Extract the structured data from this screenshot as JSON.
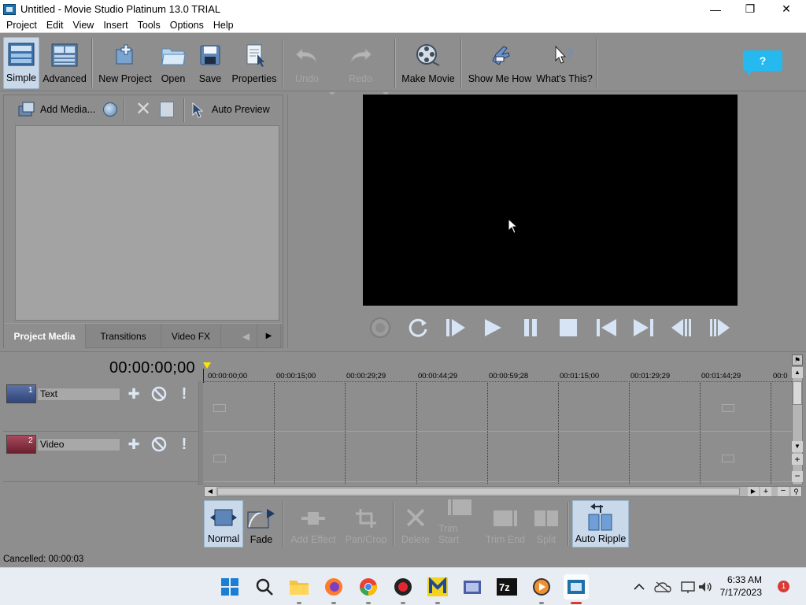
{
  "window": {
    "title": "Untitled - Movie Studio Platinum 13.0 TRIAL"
  },
  "menu": [
    "Project",
    "Edit",
    "View",
    "Insert",
    "Tools",
    "Options",
    "Help"
  ],
  "toolbar": {
    "simple": "Simple",
    "advanced": "Advanced",
    "new_project": "New Project",
    "open": "Open",
    "save": "Save",
    "properties": "Properties",
    "undo": "Undo",
    "redo": "Redo",
    "make_movie": "Make Movie",
    "show_me_how": "Show Me How",
    "whats_this": "What's This?",
    "help_bubble": "?"
  },
  "media": {
    "add_media": "Add Media...",
    "auto_preview": "Auto Preview",
    "tabs": [
      "Project Media",
      "Transitions",
      "Video FX"
    ]
  },
  "timeline": {
    "timecode": "00:00:00;00",
    "ruler": [
      "00:00:00;00",
      "00:00:15;00",
      "00:00:29;29",
      "00:00:44;29",
      "00:00:59;28",
      "00:01:15;00",
      "00:01:29;29",
      "00:01:44;29",
      "00:0"
    ],
    "tracks": [
      {
        "number": "1",
        "name": "Text"
      },
      {
        "number": "2",
        "name": "Video"
      }
    ]
  },
  "editbar": {
    "normal": "Normal",
    "fade": "Fade",
    "add_effect": "Add Effect",
    "pan_crop": "Pan/Crop",
    "delete": "Delete",
    "trim_start": "Trim Start",
    "trim_end": "Trim End",
    "split": "Split",
    "auto_ripple": "Auto Ripple"
  },
  "status": "Cancelled: 00:00:03",
  "taskbar": {
    "time": "6:33 AM",
    "date": "7/17/2023",
    "notifications": "1"
  },
  "colors": {
    "accent": "#25b9ef",
    "selected": "#c9d9ea",
    "preview_bg": "#000000",
    "workspace": "#8e8e8e"
  }
}
